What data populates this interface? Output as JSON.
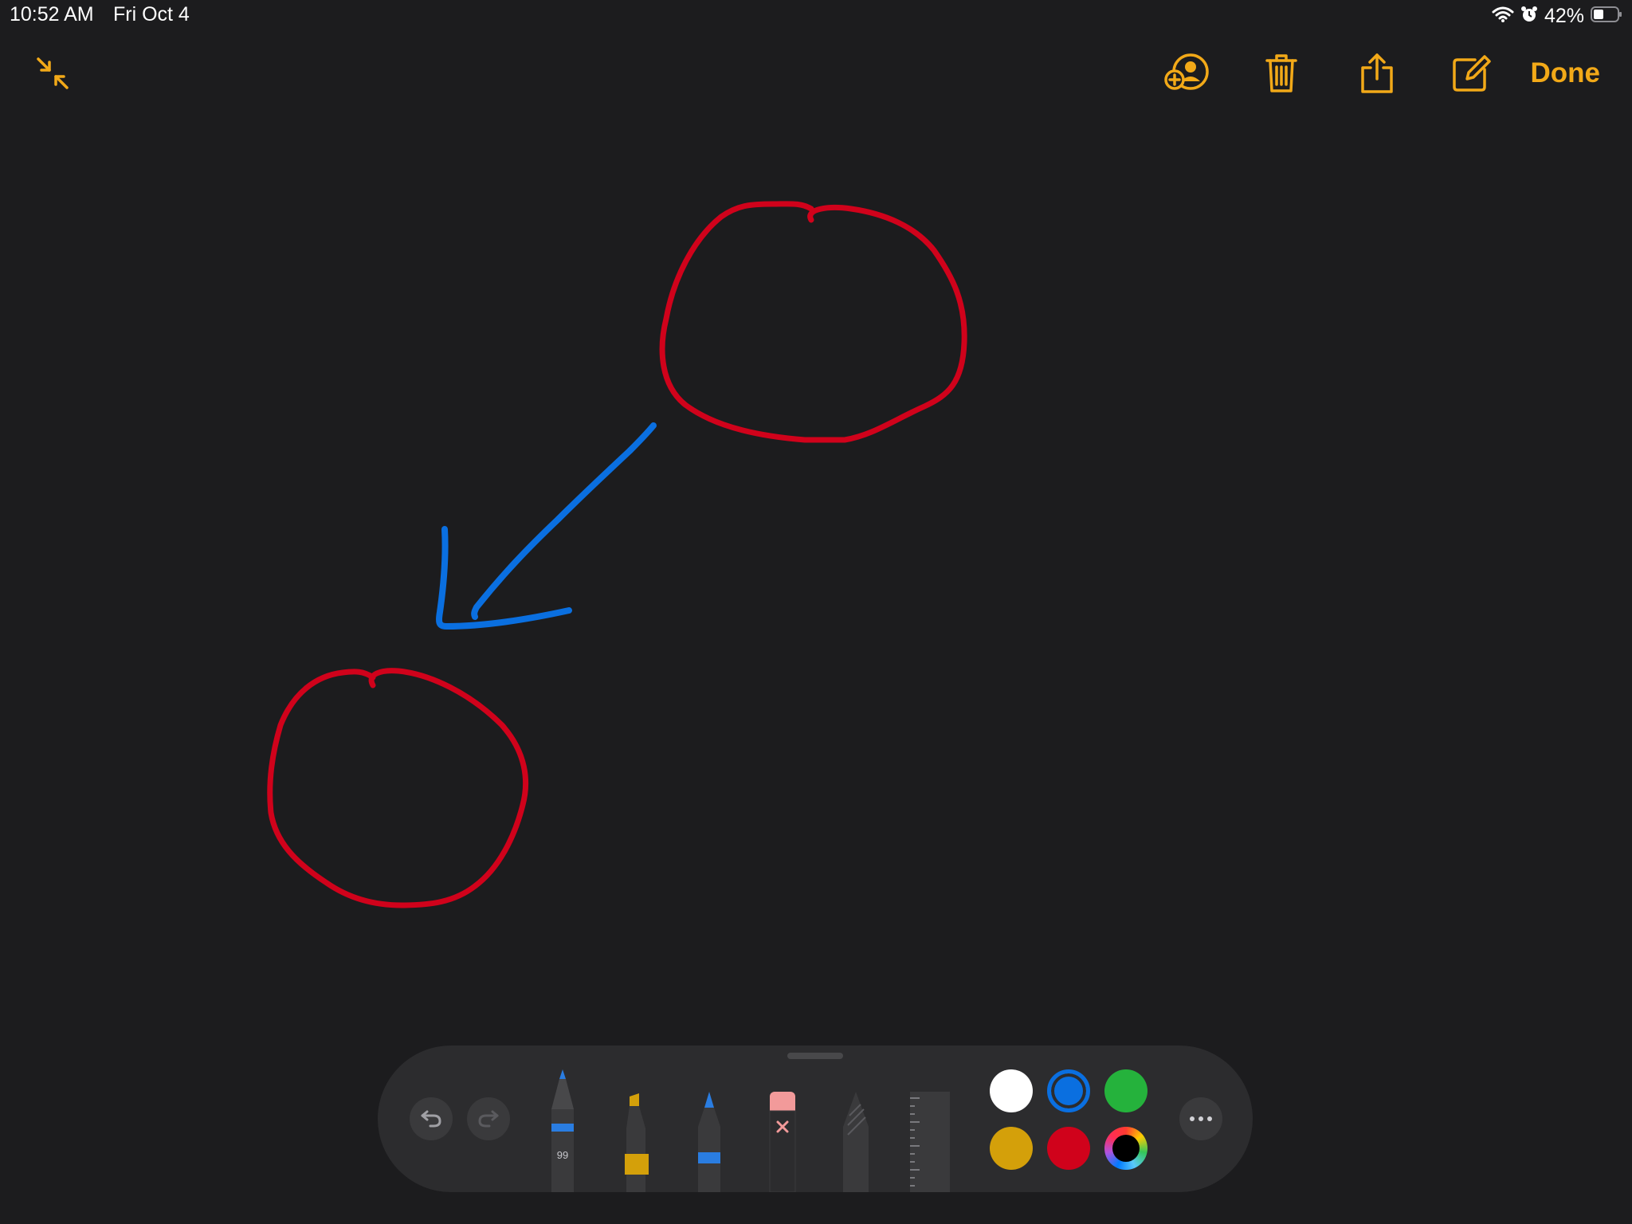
{
  "status_bar": {
    "time": "10:52 AM",
    "date": "Fri Oct 4",
    "battery_percent": "42%",
    "battery_level": 0.42,
    "icons": [
      "wifi-icon",
      "alarm-icon",
      "battery-icon"
    ]
  },
  "toolbar": {
    "icons": [
      "collapse-icon",
      "add-person-icon",
      "trash-icon",
      "share-icon",
      "compose-icon"
    ],
    "done_label": "Done",
    "accent_color": "#f2a918"
  },
  "drawing": {
    "stroke_colors": [
      "#d0021b",
      "#0a6fe0"
    ]
  },
  "palette": {
    "pen_width_label": "99",
    "tools": [
      "pen",
      "marker",
      "pencil",
      "eraser",
      "lasso",
      "ruler"
    ],
    "colors": [
      {
        "name": "white",
        "hex": "#ffffff"
      },
      {
        "name": "blue",
        "hex": "#0a6fe0",
        "selected": true
      },
      {
        "name": "green",
        "hex": "#25b23c"
      },
      {
        "name": "yellow",
        "hex": "#d4a00a"
      },
      {
        "name": "red",
        "hex": "#d0021b"
      },
      {
        "name": "color-picker",
        "hex": "#000000"
      }
    ],
    "more_icon": "ellipsis-icon"
  }
}
